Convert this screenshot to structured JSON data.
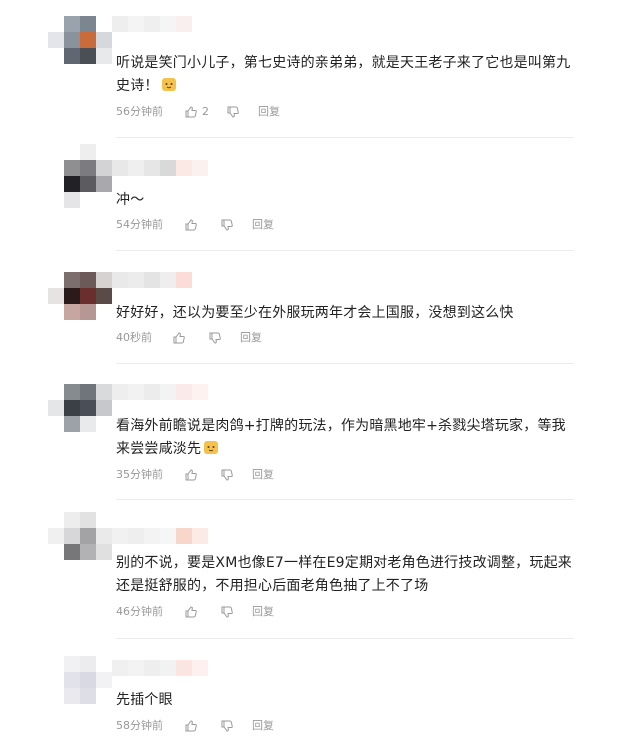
{
  "comments": [
    {
      "text": "听说是笑门小儿子，第七史诗的亲弟弟，就是天王老子来了它也是叫第九史诗！",
      "emoji": "cat-emoji",
      "time": "56分钟前",
      "like_count": "2",
      "reply_label": "回复"
    },
    {
      "text": "冲～",
      "time": "54分钟前",
      "like_count": "",
      "reply_label": "回复"
    },
    {
      "text": "好好好，还以为要至少在外服玩两年才会上国服，没想到这么快",
      "time": "40秒前",
      "like_count": "",
      "reply_label": "回复"
    },
    {
      "text": "看海外前瞻说是肉鸽+打牌的玩法，作为暗黑地牢+杀戮尖塔玩家，等我来尝尝咸淡先",
      "emoji": "cat-emoji",
      "time": "35分钟前",
      "like_count": "",
      "reply_label": "回复"
    },
    {
      "text": "别的不说，要是XM也像E7一样在E9定期对老角色进行技改调整，玩起来还是挺舒服的，不用担心后面老角色抽了上不了场",
      "time": "46分钟前",
      "like_count": "",
      "reply_label": "回复"
    },
    {
      "text": "先插个眼",
      "time": "58分钟前",
      "like_count": "",
      "reply_label": "回复"
    }
  ],
  "colors": {
    "text": "#222222",
    "meta": "#999999",
    "divider": "#ececec",
    "emoji": "#f4c24a"
  }
}
